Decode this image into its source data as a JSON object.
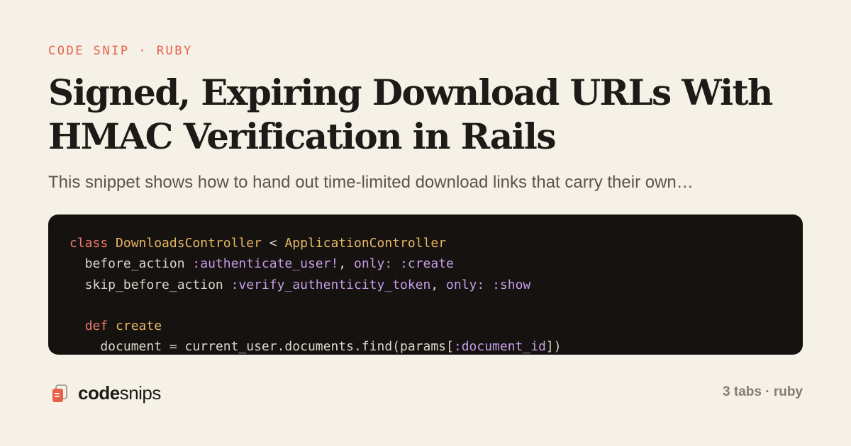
{
  "header": {
    "eyebrow": "CODE SNIP · RUBY",
    "title": "Signed, Expiring Download URLs With HMAC Verification in Rails",
    "excerpt": "This snippet shows how to hand out time-limited download links that carry their own…"
  },
  "code": {
    "language": "ruby",
    "lines": [
      [
        {
          "t": "class",
          "k": "kw"
        },
        {
          "t": " ",
          "k": "plain"
        },
        {
          "t": "DownloadsController",
          "k": "cls"
        },
        {
          "t": " < ",
          "k": "plain"
        },
        {
          "t": "ApplicationController",
          "k": "cls"
        }
      ],
      [
        {
          "t": "  before_action ",
          "k": "plain"
        },
        {
          "t": ":authenticate_user!",
          "k": "sym"
        },
        {
          "t": ", ",
          "k": "plain"
        },
        {
          "t": "only:",
          "k": "sym"
        },
        {
          "t": " ",
          "k": "plain"
        },
        {
          "t": ":create",
          "k": "sym"
        }
      ],
      [
        {
          "t": "  skip_before_action ",
          "k": "plain"
        },
        {
          "t": ":verify_authenticity_token",
          "k": "sym"
        },
        {
          "t": ", ",
          "k": "plain"
        },
        {
          "t": "only:",
          "k": "sym"
        },
        {
          "t": " ",
          "k": "plain"
        },
        {
          "t": ":show",
          "k": "sym"
        }
      ],
      [],
      [
        {
          "t": "  ",
          "k": "plain"
        },
        {
          "t": "def",
          "k": "kw"
        },
        {
          "t": " ",
          "k": "plain"
        },
        {
          "t": "create",
          "k": "cls"
        }
      ],
      [
        {
          "t": "    document = current_user.documents.find(params[",
          "k": "plain"
        },
        {
          "t": ":document_id",
          "k": "sym"
        },
        {
          "t": "])",
          "k": "plain"
        }
      ]
    ]
  },
  "footer": {
    "brand_bold": "code",
    "brand_light": "snips",
    "logo_icon": "stacked-cards-icon",
    "meta": "3 tabs · ruby"
  },
  "colors": {
    "background": "#f6f1e7",
    "accent": "#e8604a",
    "code_bg": "#151210",
    "keyword": "#f07a6b",
    "class_name": "#e8b764",
    "symbol": "#c59de6",
    "plain": "#dcd5cb"
  }
}
